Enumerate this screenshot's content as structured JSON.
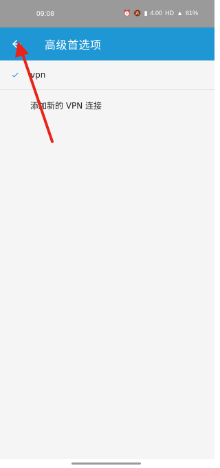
{
  "status_bar": {
    "time": "09:08",
    "icons": [
      "alarm-icon",
      "mute-icon",
      "signal-icon",
      "data-speed-icon",
      "hd-icon",
      "wifi-icon"
    ],
    "data_speed_text": "4.00",
    "battery": "61%"
  },
  "app_bar": {
    "title": "高级首选项",
    "back_icon": "arrow-left-icon",
    "color": "#1e97d4"
  },
  "list": {
    "items": [
      {
        "label": "vpn",
        "checked": true,
        "check_color": "#1e88c8"
      },
      {
        "label": "添加新的 VPN 连接",
        "checked": false
      }
    ]
  },
  "annotation": {
    "color": "#e8241a",
    "points_to": "back-button"
  }
}
